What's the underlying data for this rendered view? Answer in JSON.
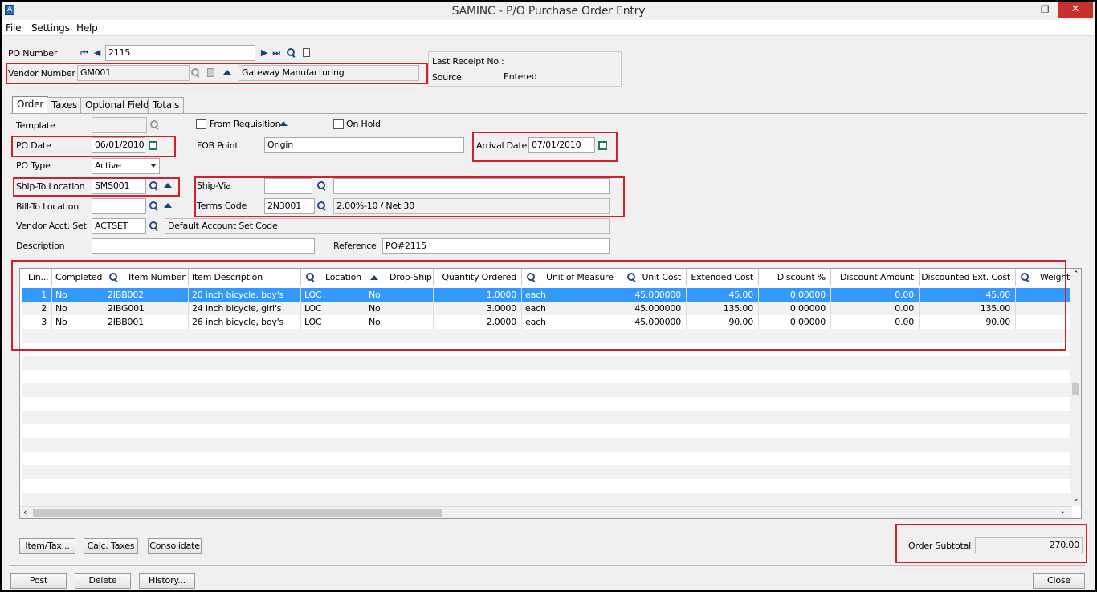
{
  "window": {
    "title": "SAMINC - P/O Purchase Order Entry",
    "app_icon": "A"
  },
  "menu": {
    "file": "File",
    "settings": "Settings",
    "help": "Help"
  },
  "header": {
    "po_number_label": "PO Number",
    "po_number": "2115",
    "vendor_number_label": "Vendor Number",
    "vendor_number": "GM001",
    "vendor_name": "Gateway Manufacturing",
    "last_receipt_label": "Last Receipt No.:",
    "last_receipt_value": "",
    "source_label": "Source:",
    "source_value": "Entered"
  },
  "tabs": [
    {
      "label": "Order",
      "active": true
    },
    {
      "label": "Taxes"
    },
    {
      "label": "Optional Fields"
    },
    {
      "label": "Totals"
    }
  ],
  "order": {
    "template_label": "Template",
    "template_value": "",
    "from_requisition_label": "From Requisition",
    "on_hold_label": "On Hold",
    "po_date_label": "PO Date",
    "po_date": "06/01/2010",
    "fob_point_label": "FOB Point",
    "fob_point": "Origin",
    "arrival_date_label": "Arrival Date",
    "arrival_date": "07/01/2010",
    "po_type_label": "PO Type",
    "po_type": "Active",
    "ship_to_label": "Ship-To Location",
    "ship_to": "SMS001",
    "ship_via_label": "Ship-Via",
    "ship_via": "",
    "ship_via_desc": "",
    "bill_to_label": "Bill-To Location",
    "bill_to": "",
    "terms_code_label": "Terms Code",
    "terms_code": "2N3001",
    "terms_desc": "2.00%-10 / Net 30",
    "vendor_acct_set_label": "Vendor Acct. Set",
    "vendor_acct_set": "ACTSET",
    "vendor_acct_set_desc": "Default Account Set Code",
    "description_label": "Description",
    "description": "",
    "reference_label": "Reference",
    "reference": "PO#2115"
  },
  "grid": {
    "columns": [
      "Lin...",
      "Completed",
      "Item Number",
      "Item Description",
      "Location",
      "Drop-Ship",
      "Quantity Ordered",
      "Unit of Measure",
      "Unit Cost",
      "Extended Cost",
      "Discount %",
      "Discount Amount",
      "Discounted Ext. Cost",
      "Weight"
    ],
    "rows": [
      [
        "1",
        "No",
        "2IBB002",
        "20 inch bicycle, boy's",
        "LOC",
        "No",
        "1.0000",
        "each",
        "45.000000",
        "45.00",
        "0.00000",
        "0.00",
        "45.00"
      ],
      [
        "2",
        "No",
        "2IBG001",
        "24 inch bicycle, girl's",
        "LOC",
        "No",
        "3.0000",
        "each",
        "45.000000",
        "135.00",
        "0.00000",
        "0.00",
        "135.00"
      ],
      [
        "3",
        "No",
        "2IBB001",
        "26 inch bicycle, boy's",
        "LOC",
        "No",
        "2.0000",
        "each",
        "45.000000",
        "90.00",
        "0.00000",
        "0.00",
        "90.00"
      ]
    ]
  },
  "footer": {
    "item_tax_label": "Item/Tax...",
    "calc_taxes_label": "Calc. Taxes",
    "consolidate_label": "Consolidate",
    "order_subtotal_label": "Order Subtotal",
    "order_subtotal": "270.00",
    "post_label": "Post",
    "delete_label": "Delete",
    "history_label": "History...",
    "close_label": "Close"
  },
  "colors": {
    "highlight": "#d0202a",
    "selection": "#3399ff"
  }
}
